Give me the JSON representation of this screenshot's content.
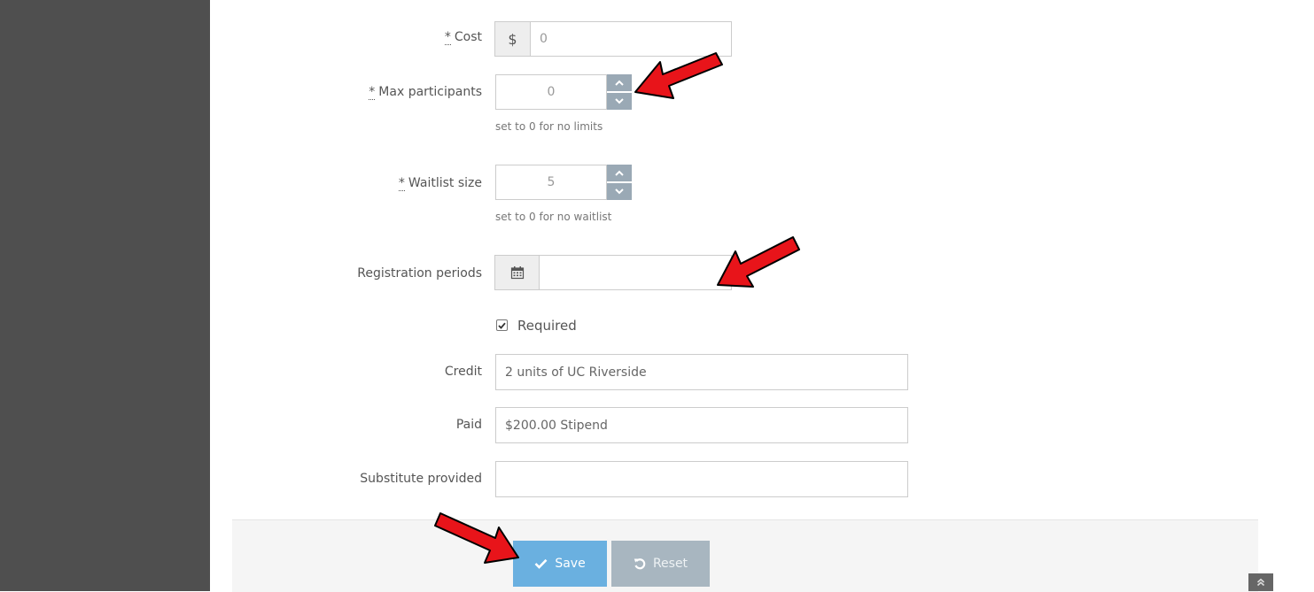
{
  "form": {
    "cost": {
      "required_mark": "*",
      "label": "Cost",
      "addon": "$",
      "value": "0"
    },
    "max_participants": {
      "required_mark": "*",
      "label": "Max participants",
      "value": "0",
      "help": "set to 0 for no limits"
    },
    "waitlist_size": {
      "required_mark": "*",
      "label": "Waitlist size",
      "value": "5",
      "help": "set to 0 for no waitlist"
    },
    "registration_periods": {
      "label": "Registration periods",
      "value": ""
    },
    "required_checkbox": {
      "label": "Required",
      "checked": true
    },
    "credit": {
      "label": "Credit",
      "value": "2 units of UC Riverside"
    },
    "paid": {
      "label": "Paid",
      "value": "$200.00 Stipend"
    },
    "substitute_provided": {
      "label": "Substitute provided",
      "value": ""
    }
  },
  "actions": {
    "save_label": "Save",
    "reset_label": "Reset"
  },
  "icons": {
    "spinner_up": "chevron-up-icon",
    "spinner_down": "chevron-down-icon",
    "calendar": "calendar-icon",
    "check": "check-icon",
    "reset": "undo-icon",
    "scroll_top": "double-chevron-up-icon"
  },
  "colors": {
    "sidebar": "#4f4f4f",
    "save_button": "#6ab0e0",
    "reset_button": "#a8b6c0",
    "spinner": "#9aa9b5",
    "annotation_arrow": "#e8141a"
  }
}
